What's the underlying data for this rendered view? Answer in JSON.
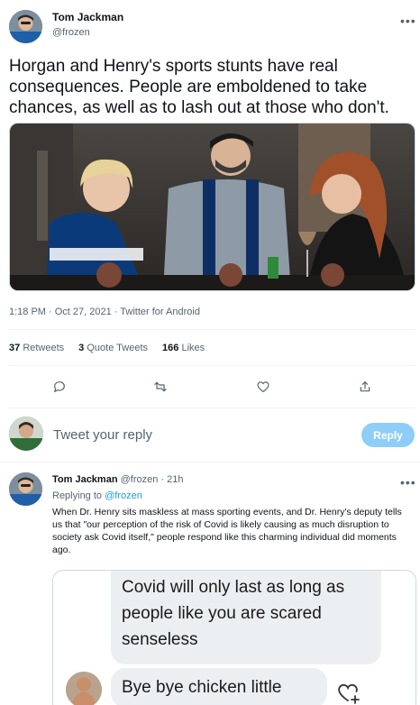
{
  "tweet": {
    "author_name": "Tom Jackman",
    "author_handle": "@frozen",
    "text": "Horgan and Henry's sports stunts have real consequences. People are emboldened to take chances, as well as to lash out at those who don't.",
    "timestamp": "1:18 PM · Oct 27, 2021 · Twitter for Android",
    "stats": {
      "retweets_count": "37",
      "retweets_label": "Retweets",
      "quotes_count": "3",
      "quotes_label": "Quote Tweets",
      "likes_count": "166",
      "likes_label": "Likes"
    }
  },
  "composer": {
    "placeholder": "Tweet your reply",
    "button_label": "Reply"
  },
  "reply": {
    "author_name": "Tom Jackman",
    "author_handle": "@frozen",
    "time": "21h",
    "replying_prefix": "Replying to",
    "replying_to": "@frozen",
    "text": "When Dr. Henry sits maskless at mass sporting events, and Dr. Henry's deputy tells us that \"our perception of the risk of Covid is likely causing as much disruption to society ask Covid itself,\" people respond like this charming individual did moments ago.",
    "chat": {
      "message_1": "Covid will only last as long as people like you are scared senseless",
      "message_2": "Bye bye chicken little"
    }
  },
  "icons": {
    "more": "more-icon",
    "reply": "reply-icon",
    "retweet": "retweet-icon",
    "like": "heart-icon",
    "share": "share-icon"
  },
  "colors": {
    "accent": "#1d9bf0",
    "reply_button_disabled": "#8ecdf8",
    "secondary_text": "#536471"
  }
}
